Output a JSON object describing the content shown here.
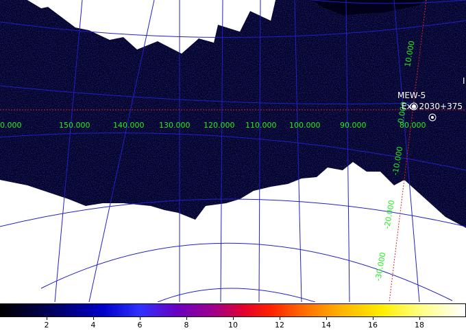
{
  "colors": {
    "background": "#ffffff",
    "survey_fill": "#000018",
    "grid_lines": "#2020c8",
    "axis_lines": "#e02020",
    "coord_labels": "#22ee22",
    "source_labels": "#ffffff"
  },
  "coordinate_labels": {
    "longitude": [
      "0.000",
      "150.000",
      "140.000",
      "130.000",
      "120.000",
      "110.000",
      "100.000",
      "90.000",
      "80.000"
    ],
    "latitude": [
      "10.000",
      "0.000",
      "-10.000",
      "-20.000",
      "-30.000"
    ]
  },
  "sources": {
    "label_a": "MEW-5",
    "label_b": "Exo 2030+375",
    "right_edge_mark": "I"
  },
  "colorbar": {
    "ticks": [
      "2",
      "4",
      "6",
      "8",
      "10",
      "12",
      "14",
      "16",
      "18"
    ],
    "min": 0,
    "max": 20
  }
}
